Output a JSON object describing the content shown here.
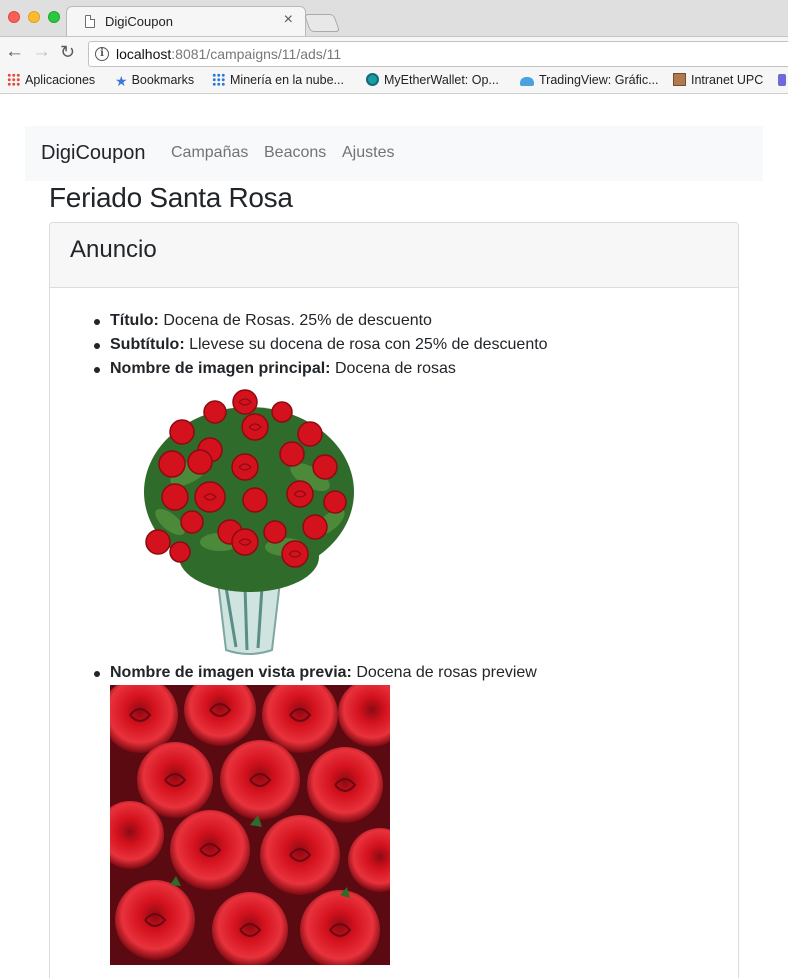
{
  "browser": {
    "tab_title": "DigiCoupon",
    "tab_close": "×",
    "url_host": "localhost",
    "url_path": ":8081/campaigns/11/ads/11",
    "bookmarks": [
      {
        "label": "Aplicaciones",
        "icon": "apps-grid-icon"
      },
      {
        "label": "Bookmarks",
        "icon": "star-icon"
      },
      {
        "label": "Minería en la nube...",
        "icon": "grid-icon"
      },
      {
        "label": "MyEtherWallet: Op...",
        "icon": "ether-icon"
      },
      {
        "label": "TradingView: Gráfic...",
        "icon": "cloud-icon"
      },
      {
        "label": "Intranet UPC",
        "icon": "favicon-photo-icon"
      }
    ]
  },
  "navbar": {
    "brand": "DigiCoupon",
    "links": [
      "Campañas",
      "Beacons",
      "Ajustes"
    ]
  },
  "page": {
    "title": "Feriado Santa Rosa",
    "card_title": "Anuncio",
    "fields": [
      {
        "label": "Título:",
        "value": "Docena de Rosas. 25% de descuento"
      },
      {
        "label": "Subtítulo:",
        "value": "Llevese su docena de rosa con 25% de descuento"
      },
      {
        "label": "Nombre de imagen principal:",
        "value": "Docena de rosas"
      },
      {
        "label": "Nombre de imagen vista previa:",
        "value": "Docena de rosas preview"
      }
    ]
  },
  "colors": {
    "rose": "#d4121e",
    "leaf": "#2f6b2a",
    "navbar_bg": "#f8f9fa"
  }
}
